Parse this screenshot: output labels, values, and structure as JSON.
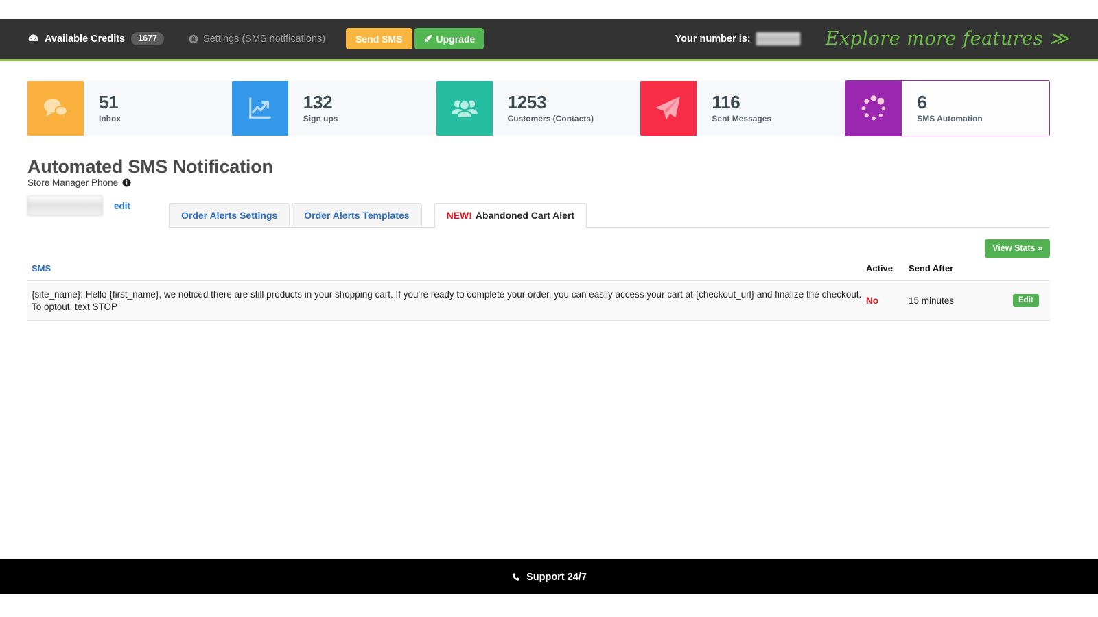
{
  "topbar": {
    "credits_icon": "tachometer-icon",
    "credits_label": "Available Credits",
    "credits_value": "1677",
    "settings_icon": "lock-icon",
    "settings_label": "Settings (SMS notifications)",
    "send_sms_label": "Send SMS",
    "upgrade_icon": "rocket-icon",
    "upgrade_label": "Upgrade",
    "your_number_label": "Your number is:",
    "your_number_value": "",
    "explore_label": "Explore more features ≫",
    "accent_green": "#8cc63e",
    "background": "#333333",
    "send_sms_color": "#f9b63f",
    "upgrade_color": "#53b751"
  },
  "cards": [
    {
      "value": "51",
      "label": "Inbox",
      "color": "#f9b03c",
      "icon": "chat-bubbles-icon",
      "active": false
    },
    {
      "value": "132",
      "label": "Sign ups",
      "color": "#3498ea",
      "icon": "line-chart-icon",
      "active": false
    },
    {
      "value": "1253",
      "label": "Customers (Contacts)",
      "color": "#25bda0",
      "icon": "users-group-icon",
      "active": false
    },
    {
      "value": "116",
      "label": "Sent Messages",
      "color": "#f72c46",
      "icon": "paper-plane-icon",
      "active": false
    },
    {
      "value": "6",
      "label": "SMS Automation",
      "color": "#9b27b0",
      "icon": "spinner-dots-icon",
      "active": true
    }
  ],
  "main": {
    "page_title": "Automated SMS Notification",
    "phone_label": "Store Manager Phone",
    "phone_info_icon": "info-icon",
    "phone_value": "",
    "edit_link_label": "edit",
    "view_stats_label": "View Stats »"
  },
  "tabs": [
    {
      "label": "Order Alerts Settings",
      "new_flag": "",
      "active": false
    },
    {
      "label": "Order Alerts Templates",
      "new_flag": "",
      "active": false
    },
    {
      "label": "Abandoned Cart Alert",
      "new_flag": "NEW!",
      "active": true
    }
  ],
  "table": {
    "headers": {
      "sms": "SMS",
      "active": "Active",
      "send_after": "Send After",
      "edit": ""
    },
    "rows": [
      {
        "sms": "{site_name}: Hello {first_name}, we noticed there are still products in your shopping cart. If you're ready to complete your order, you can easily access your cart at {checkout_url} and finalize the checkout. To optout, text STOP",
        "active": "No",
        "send_after": "15 minutes",
        "edit_label": "Edit"
      }
    ]
  },
  "footer": {
    "icon": "phone-icon",
    "label": "Support 24/7"
  }
}
